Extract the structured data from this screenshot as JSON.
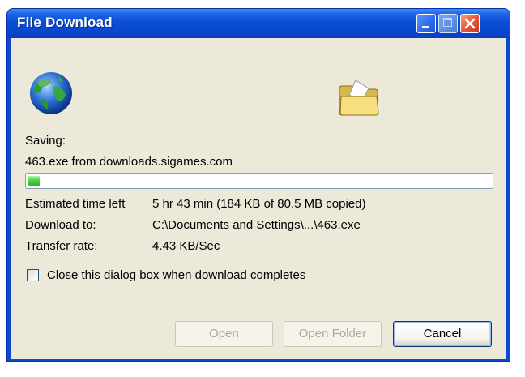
{
  "window": {
    "title": "File Download"
  },
  "status": {
    "saving_label": "Saving:",
    "file_source": "463.exe from downloads.sigames.com",
    "progress_fraction": 0.025
  },
  "details": {
    "estimated_label": "Estimated time left",
    "estimated_value": "5 hr 43 min (184 KB of 80.5 MB copied)",
    "download_to_label": "Download to:",
    "download_to_value": "C:\\Documents and Settings\\...\\463.exe",
    "transfer_label": "Transfer rate:",
    "transfer_value": "4.43 KB/Sec"
  },
  "options": {
    "close_when_done_label": "Close this dialog box when download completes",
    "close_when_done_checked": false
  },
  "buttons": {
    "open": "Open",
    "open_folder": "Open Folder",
    "cancel": "Cancel"
  },
  "icons": {
    "globe": "globe-icon",
    "folder": "folder-icon",
    "minimize": "minimize-icon",
    "maximize": "maximize-icon",
    "close": "close-icon"
  },
  "colors": {
    "titlebar": "#0a4ed8",
    "client_bg": "#ece9d8",
    "progress_fill": "#2fb52a"
  }
}
